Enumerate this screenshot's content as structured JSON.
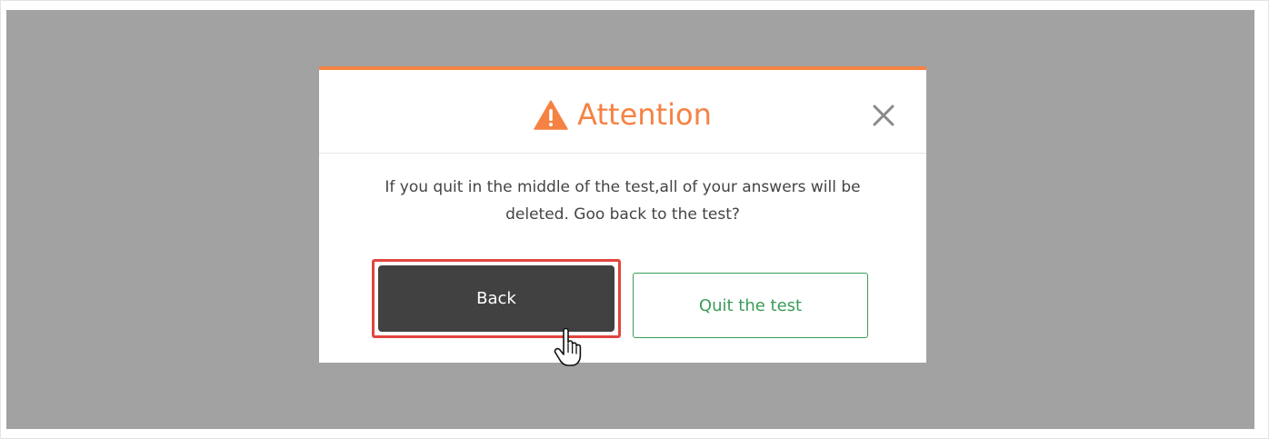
{
  "dialog": {
    "title": "Attention",
    "title_icon": "warning-triangle-icon",
    "close_icon": "close-icon",
    "message_line1": "If you quit in the middle of the test,all of your answers will be",
    "message_line2": "deleted. Goo back to the test?",
    "back_label": "Back",
    "quit_label": "Quit the test"
  },
  "colors": {
    "accent": "#f58243",
    "overlay": "#a2a2a2",
    "back_button": "#414141",
    "quit_button": "#3a9c58",
    "highlight": "#e2463e"
  }
}
